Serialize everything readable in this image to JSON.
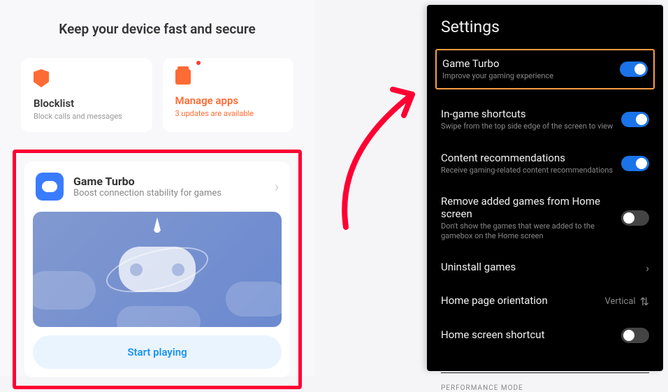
{
  "left": {
    "header": "Keep your device fast and secure",
    "blocklist": {
      "title": "Blocklist",
      "subtitle": "Block calls and messages"
    },
    "manageapps": {
      "title": "Manage apps",
      "subtitle": "3 updates are available"
    },
    "gameturbo": {
      "title": "Game Turbo",
      "subtitle": "Boost connection stability for games"
    },
    "startBtn": "Start playing"
  },
  "right": {
    "title": "Settings",
    "items": [
      {
        "title": "Game Turbo",
        "desc": "Improve your gaming experience",
        "toggle": "on"
      },
      {
        "title": "In-game shortcuts",
        "desc": "Swipe from the top side edge of the screen to view",
        "toggle": "on"
      },
      {
        "title": "Content recommendations",
        "desc": "Receive gaming-related content recommendations",
        "toggle": "on"
      },
      {
        "title": "Remove added games from Home screen",
        "desc": "Don't show the games that were added to the gamebox on the Home screen",
        "toggle": "off"
      },
      {
        "title": "Uninstall games",
        "type": "nav"
      },
      {
        "title": "Home page orientation",
        "value": "Vertical",
        "type": "value"
      },
      {
        "title": "Home screen shortcut",
        "toggle": "off"
      }
    ],
    "section": "PERFORMANCE MODE"
  }
}
